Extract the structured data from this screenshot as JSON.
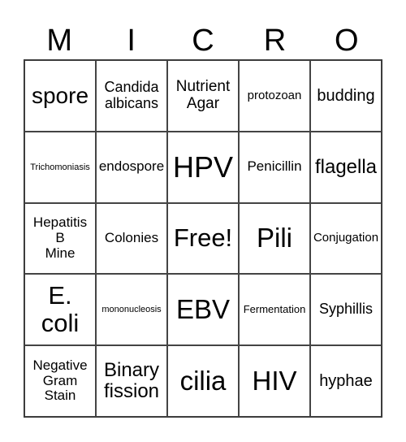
{
  "header": {
    "letters": [
      "M",
      "I",
      "C",
      "R",
      "O"
    ]
  },
  "cells": [
    {
      "text": "spore",
      "size": "s28"
    },
    {
      "text": "Candida\nalbicans",
      "size": "s18"
    },
    {
      "text": "Nutrient\nAgar",
      "size": "s19"
    },
    {
      "text": "protozoan",
      "size": "s14"
    },
    {
      "text": "budding",
      "size": "s21"
    },
    {
      "text": "Trichomoniasis",
      "size": "s11"
    },
    {
      "text": "endospore",
      "size": "s17"
    },
    {
      "text": "HPV",
      "size": "s36"
    },
    {
      "text": "Penicillin",
      "size": "s17"
    },
    {
      "text": "flagella",
      "size": "s24"
    },
    {
      "text": "Hepatitis\nB\nMine",
      "size": "s17"
    },
    {
      "text": "Colonies",
      "size": "s17"
    },
    {
      "text": "Free!",
      "size": "s31"
    },
    {
      "text": "Pili",
      "size": "s33"
    },
    {
      "text": "Conjugation",
      "size": "s14"
    },
    {
      "text": "E.\ncoli",
      "size": "s31"
    },
    {
      "text": "mononucleosis",
      "size": "s11"
    },
    {
      "text": "EBV",
      "size": "s33"
    },
    {
      "text": "Fermentation",
      "size": "s12"
    },
    {
      "text": "Syphillis",
      "size": "s18"
    },
    {
      "text": "Negative\nGram\nStain",
      "size": "s17"
    },
    {
      "text": "Binary\nfission",
      "size": "s24"
    },
    {
      "text": "cilia",
      "size": "s33"
    },
    {
      "text": "HIV",
      "size": "s33"
    },
    {
      "text": "hyphae",
      "size": "s21"
    }
  ]
}
